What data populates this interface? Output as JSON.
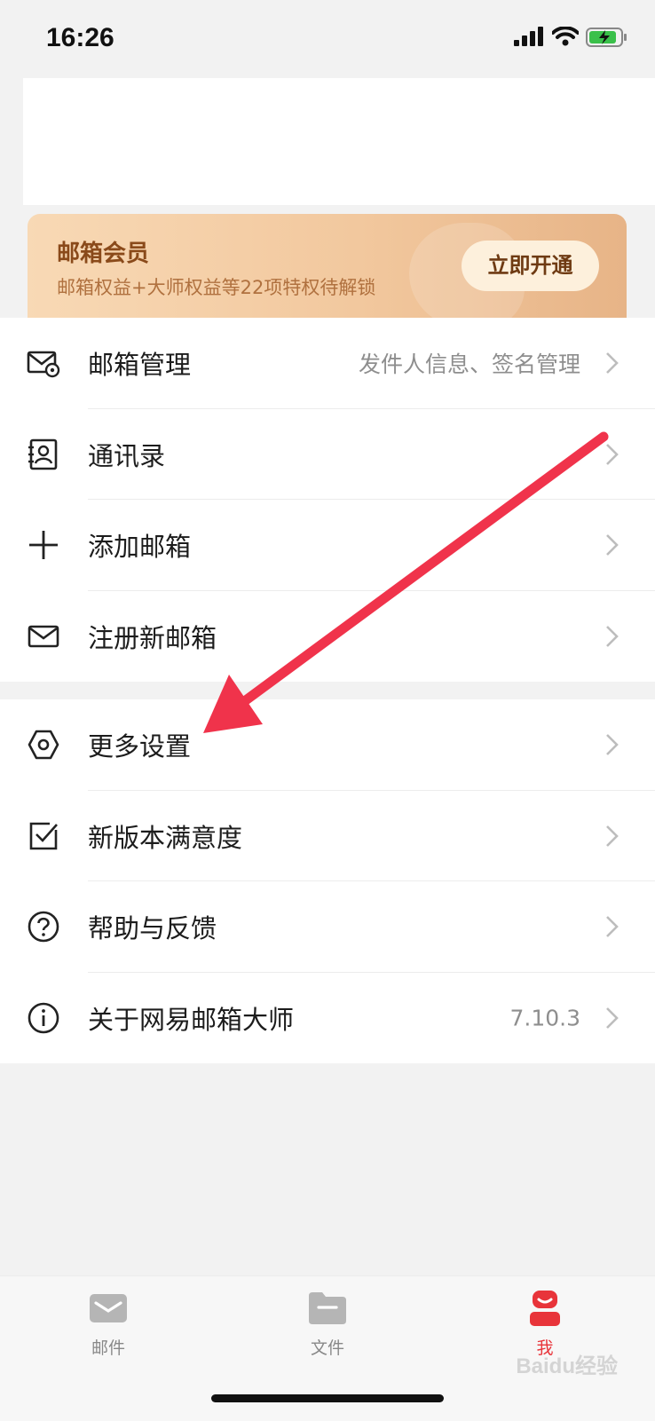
{
  "status_bar": {
    "time": "16:26"
  },
  "vip_banner": {
    "title": "邮箱会员",
    "subtitle": "邮箱权益+大师权益等22项特权待解锁",
    "button_label": "立即开通"
  },
  "menu_group_1": [
    {
      "icon": "mail-settings-icon",
      "label": "邮箱管理",
      "value": "发件人信息、签名管理"
    },
    {
      "icon": "contacts-icon",
      "label": "通讯录",
      "value": ""
    },
    {
      "icon": "plus-icon",
      "label": "添加邮箱",
      "value": ""
    },
    {
      "icon": "envelope-icon",
      "label": "注册新邮箱",
      "value": ""
    }
  ],
  "menu_group_2": [
    {
      "icon": "hexagon-settings-icon",
      "label": "更多设置",
      "value": ""
    },
    {
      "icon": "checkbox-icon",
      "label": "新版本满意度",
      "value": ""
    },
    {
      "icon": "help-icon",
      "label": "帮助与反馈",
      "value": ""
    },
    {
      "icon": "info-icon",
      "label": "关于网易邮箱大师",
      "value": "7.10.3"
    }
  ],
  "tab_bar": {
    "tabs": [
      {
        "icon": "mail-tab-icon",
        "label": "邮件"
      },
      {
        "icon": "folder-tab-icon",
        "label": "文件"
      },
      {
        "icon": "profile-tab-icon",
        "label": "我"
      }
    ],
    "active_index": 2
  },
  "watermark": "Baidu经验",
  "colors": {
    "accent": "#e8343a",
    "arrow": "#f0334b",
    "vip_gradient_start": "#f8d9b5",
    "vip_gradient_end": "#e7b487"
  }
}
